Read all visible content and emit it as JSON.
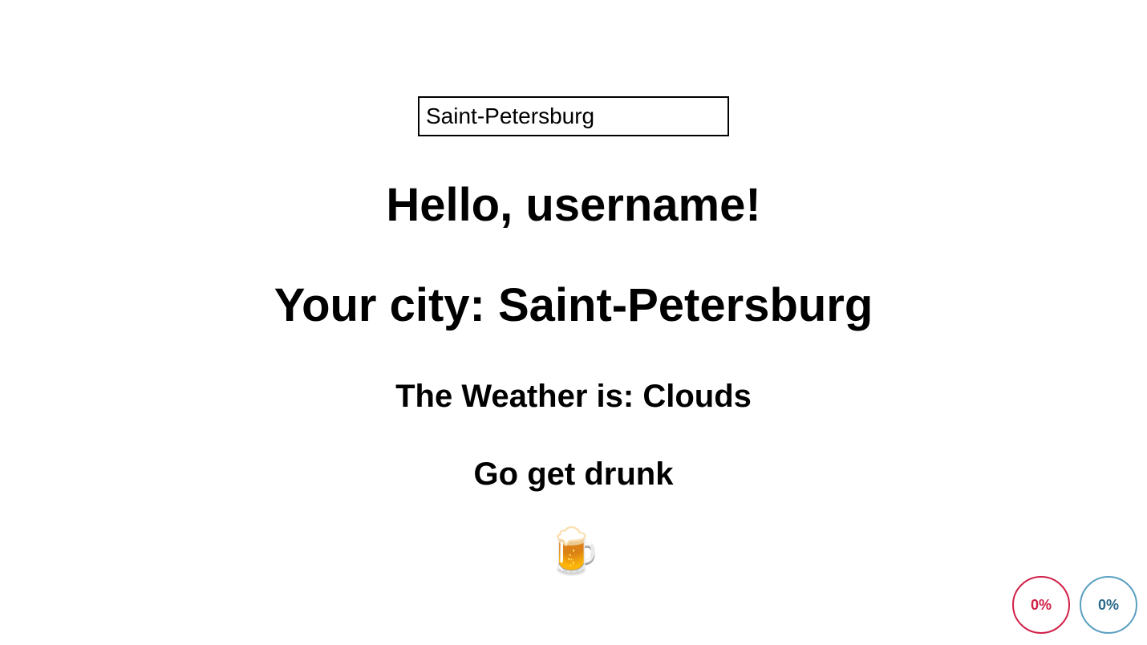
{
  "input": {
    "value": "Saint-Petersburg"
  },
  "greeting": "Hello, username!",
  "city_prefix": "Your city: ",
  "city_name": "Saint-Petersburg",
  "weather_prefix": "The Weather is: ",
  "weather_value": "Clouds",
  "advice": "Go get drunk",
  "emoji": "🍺",
  "circles": {
    "left": "0%",
    "right": "0%"
  }
}
